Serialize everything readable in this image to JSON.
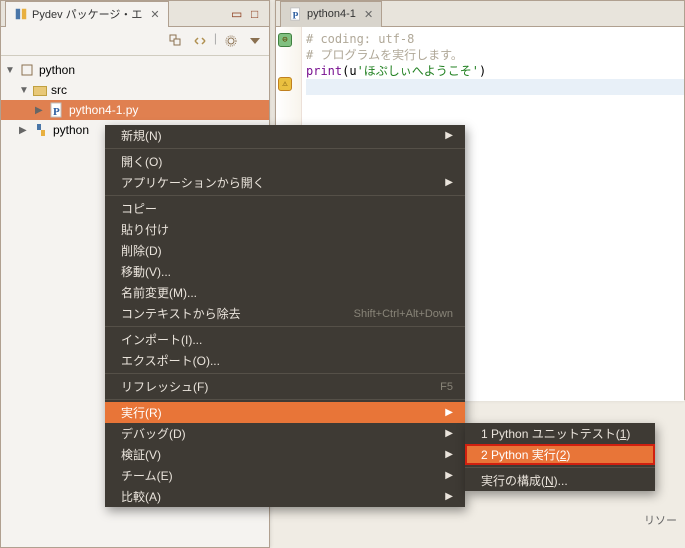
{
  "leftPanel": {
    "title": "Pydev パッケージ・エ",
    "tree": {
      "project": "python",
      "src": "src",
      "file1": "python4-1.py",
      "file2": "python"
    }
  },
  "editor": {
    "tabTitle": "python4-1",
    "line1": "# coding: utf-8",
    "line2": "# プログラムを実行します。",
    "line3a": "print",
    "line3b": "(u",
    "line3c": "'ほぷしぃへようこそ'",
    "line3d": ")"
  },
  "contextMenu": {
    "items": {
      "new": "新規(N)",
      "open": "開く(O)",
      "openWithApp": "アプリケーションから開く",
      "copy": "コピー",
      "paste": "貼り付け",
      "delete": "削除(D)",
      "move": "移動(V)...",
      "rename": "名前変更(M)...",
      "removeFromContext": "コンテキストから除去",
      "removeFromContextShortcut": "Shift+Ctrl+Alt+Down",
      "import": "インポート(I)...",
      "export": "エクスポート(O)...",
      "refresh": "リフレッシュ(F)",
      "refreshShortcut": "F5",
      "run": "実行(R)",
      "debug": "デバッグ(D)",
      "verify": "検証(V)",
      "team": "チーム(E)",
      "compare": "比較(A)"
    }
  },
  "submenu": {
    "unitTestPrefix": "1 Python ユニットテスト(",
    "unitTestMnemo": "1",
    "unitTestSuffix": ")",
    "runPrefix": "2 Python 実行(",
    "runMnemo": "2",
    "runSuffix": ")",
    "configurePrefix": "実行の構成(",
    "configureMnemo": "N",
    "configureSuffix": ")..."
  },
  "icons": {
    "minimize": "▭",
    "maximize": "□"
  },
  "resource": "リソー"
}
